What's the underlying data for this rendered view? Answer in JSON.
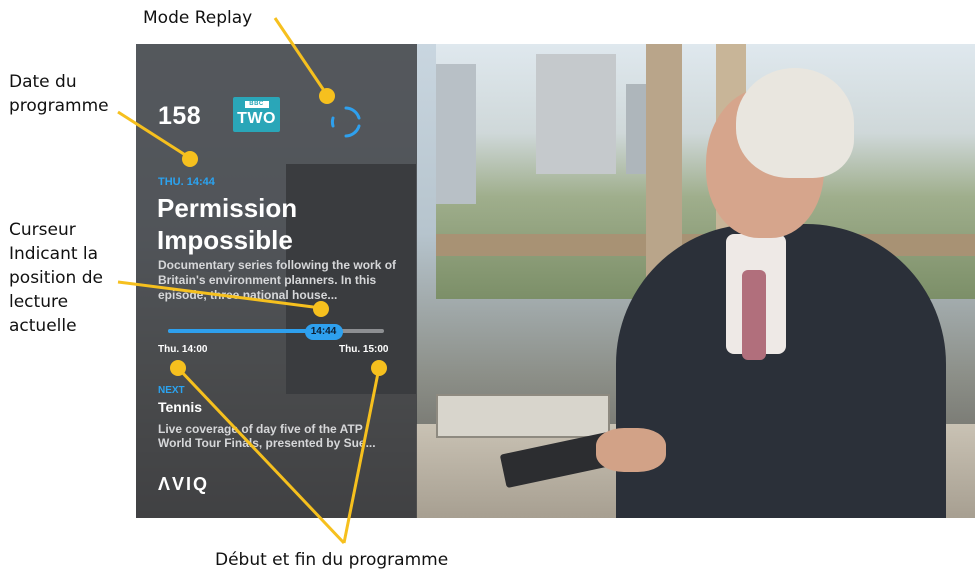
{
  "annotations": {
    "replay_mode": "Mode Replay",
    "program_date": "Date du\nprogramme",
    "cursor": "Curseur\nIndicant la\nposition de\nlecture\nactuelle",
    "program_span": "Début et fin du programme"
  },
  "panel": {
    "channel_number": "158",
    "channel_logo_top": "BBC",
    "channel_logo_main": "TWO",
    "replay_icon": "replay-spinner-icon",
    "current": {
      "start_label": "THU. 14:44",
      "title": "Permission Impossible",
      "description": "Documentary series following the work of Britain's environment planners. In this episode, three national house..."
    },
    "progress": {
      "fraction": 0.72,
      "cursor_label": "14:44",
      "start_time": "Thu. 14:00",
      "end_time": "Thu. 15:00"
    },
    "next": {
      "label": "NEXT",
      "title": "Tennis",
      "description": "Live coverage of day five of the ATP World Tour Finals, presented by Sue..."
    },
    "brand": "ΛVIQ"
  },
  "colors": {
    "accent": "#2ea0ee",
    "callout": "#f6c01e",
    "panel_bg": "#3a3c3f"
  }
}
